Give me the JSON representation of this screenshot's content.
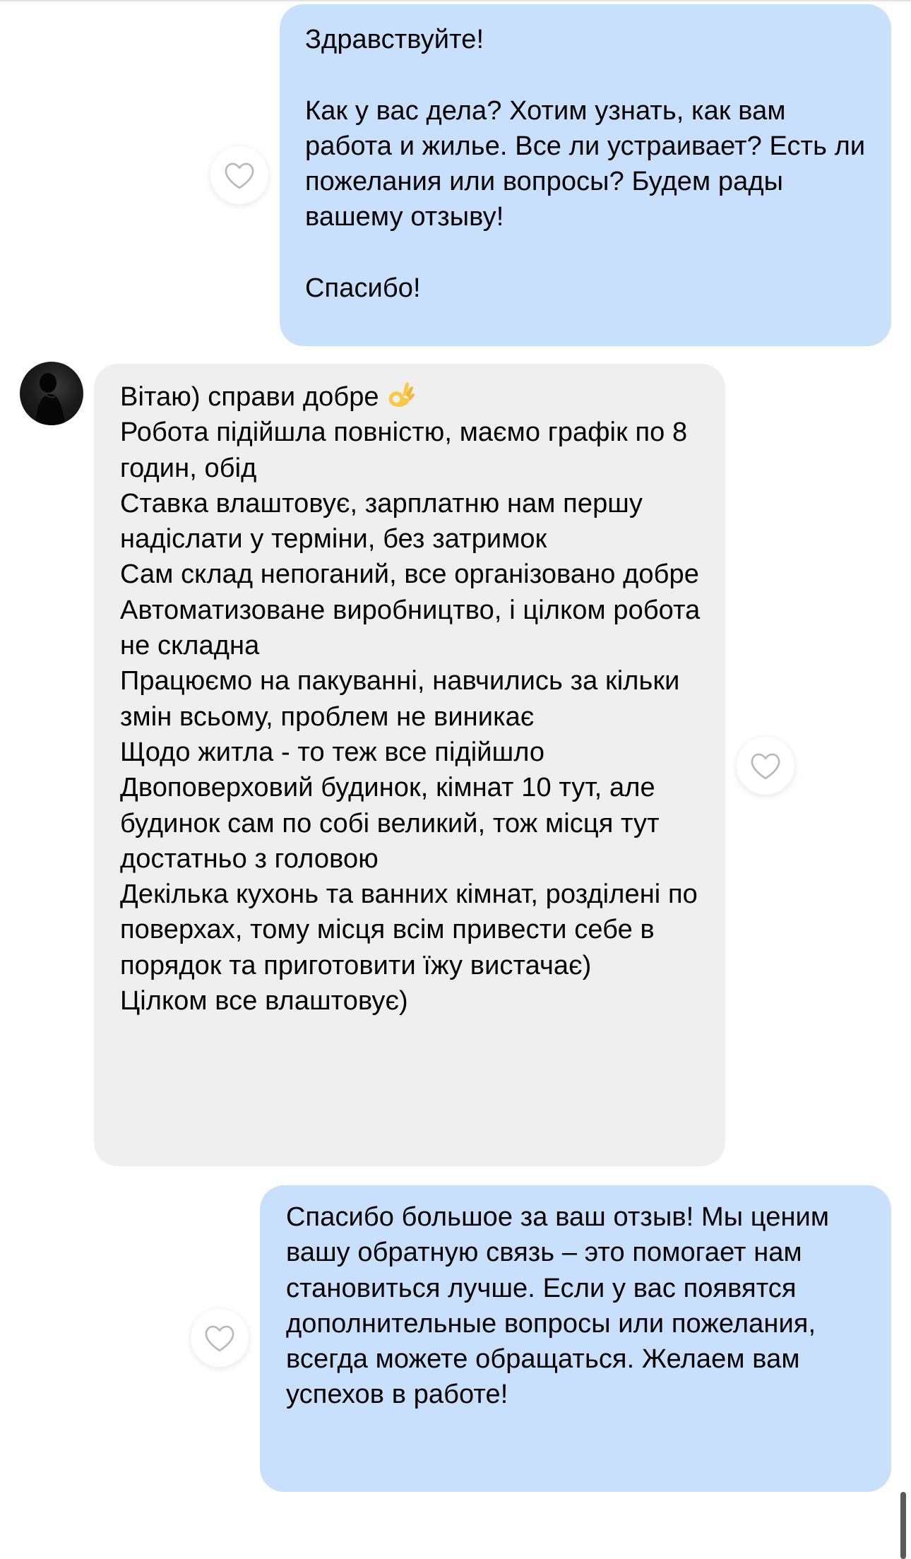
{
  "colors": {
    "outgoing_bubble": "#c8e0fb",
    "incoming_bubble": "#efefef",
    "background": "#ffffff"
  },
  "messages": [
    {
      "direction": "outgoing",
      "text": "Здравствуйте!\n\nКак у вас дела? Хотим узнать, как вам работа и жилье. Все ли устраивает? Есть ли пожелания или вопросы? Будем рады вашему отзыву!\n\nСпасибо!",
      "like_icon": "heart-outline-icon"
    },
    {
      "direction": "incoming",
      "first_line": "Вітаю) справи добре",
      "emoji": "ok-hand-emoji",
      "text": "Робота підійшла повністю, маємо графік по 8 годин, обід\nСтавка влаштовує, зарплатню нам першу надіслати у терміни, без затримок\nСам склад непоганий, все організовано добре\nАвтоматизоване виробництво, і цілком робота не складна\nПрацюємо на пакуванні, навчились за кільки змін всьому, проблем не виникає\nЩодо житла - то теж все підійшло\nДвоповерховий будинок, кімнат 10 тут, але будинок сам по собі великий, тож місця тут достатньо з головою\nДекілька кухонь та ванних кімнат, розділені по поверхах, тому місця всім привести себе в порядок та приготовити їжу вистачає)\nЦілком все влаштовує)",
      "like_icon": "heart-outline-icon",
      "avatar_icon": "user-avatar-icon"
    },
    {
      "direction": "outgoing",
      "text": "Спасибо большое за ваш отзыв! Мы ценим вашу обратную связь – это помогает нам становиться лучше. Если у вас появятся дополнительные вопросы или пожелания, всегда можете обращаться. Желаем вам успехов в работе!",
      "like_icon": "heart-outline-icon"
    }
  ]
}
